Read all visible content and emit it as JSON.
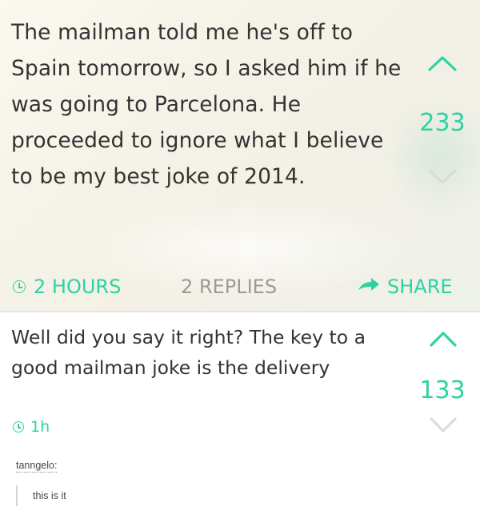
{
  "post": {
    "text": "The mailman told me he's off to Spain tomorrow, so I asked him if he was going to Parcelona. He proceeded to ignore what I believe to be my best joke of 2014.",
    "votes": "233",
    "time": "2 HOURS",
    "replies": "2 REPLIES",
    "share": "SHARE"
  },
  "reply": {
    "text": "Well did you say it right? The key to a good mailman joke is the delivery",
    "votes": "133",
    "time": "1h"
  },
  "tumblr": {
    "username": "tanngelo:",
    "comment": "this is it"
  },
  "colors": {
    "accent": "#2bd3a0",
    "muted": "#9a9a9a",
    "text": "#333333"
  },
  "icons": [
    "chevron-up-icon",
    "chevron-down-icon",
    "clock-icon",
    "share-arrow-icon"
  ]
}
